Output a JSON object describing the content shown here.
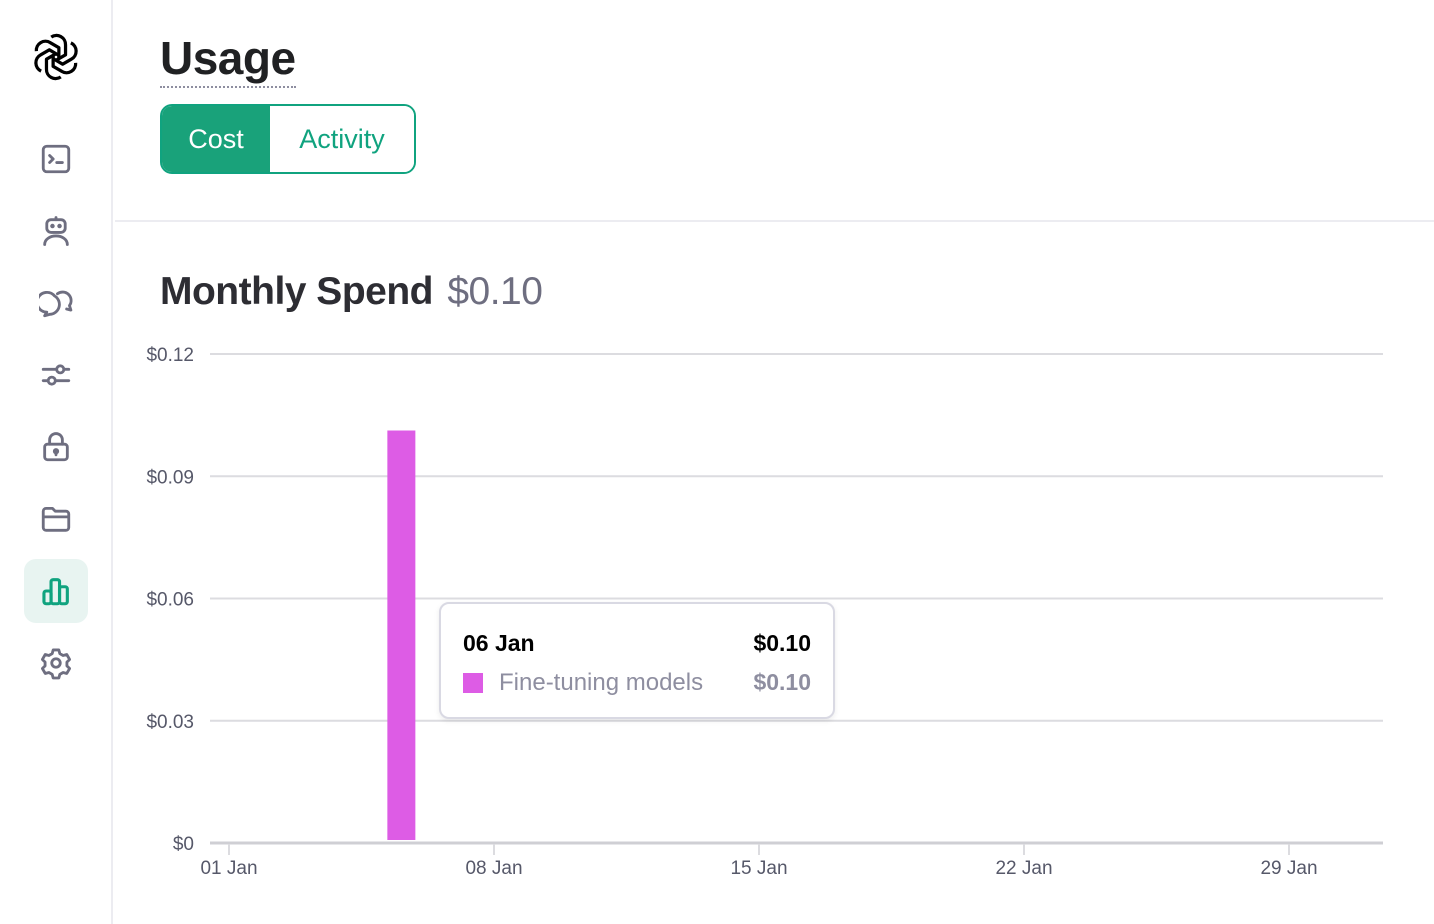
{
  "sidebar": {
    "logo": "openai-logo",
    "items": [
      {
        "name": "playground",
        "icon": "terminal-icon",
        "active": false
      },
      {
        "name": "assistants",
        "icon": "robot-icon",
        "active": false
      },
      {
        "name": "threads",
        "icon": "chat-bubbles-icon",
        "active": false
      },
      {
        "name": "fine-tuning",
        "icon": "sliders-icon",
        "active": false
      },
      {
        "name": "api-keys",
        "icon": "lock-icon",
        "active": false
      },
      {
        "name": "files",
        "icon": "folder-icon",
        "active": false
      },
      {
        "name": "usage",
        "icon": "bar-chart-icon",
        "active": true
      },
      {
        "name": "settings",
        "icon": "gear-icon",
        "active": false
      }
    ],
    "active_color": "#10a37f"
  },
  "header": {
    "title": "Usage",
    "tabs": [
      {
        "label": "Cost",
        "active": true
      },
      {
        "label": "Activity",
        "active": false
      }
    ]
  },
  "section": {
    "title": "Monthly Spend",
    "amount": "$0.10"
  },
  "tooltip": {
    "date": "06 Jan",
    "total": "$0.10",
    "rows": [
      {
        "label": "Fine-tuning models",
        "value": "$0.10",
        "color": "#dd5ce5"
      }
    ]
  },
  "chart_data": {
    "type": "bar",
    "title": "Monthly Spend",
    "xlabel": "",
    "ylabel": "",
    "x_days": [
      1,
      2,
      3,
      4,
      5,
      6,
      7,
      8,
      9,
      10,
      11,
      12,
      13,
      14,
      15,
      16,
      17,
      18,
      19,
      20,
      21,
      22,
      23,
      24,
      25,
      26,
      27,
      28,
      29,
      30,
      31
    ],
    "series": [
      {
        "name": "Fine-tuning models",
        "color": "#dd5ce5",
        "values": [
          0,
          0,
          0,
          0,
          0,
          0.1,
          0,
          0,
          0,
          0,
          0,
          0,
          0,
          0,
          0,
          0,
          0,
          0,
          0,
          0,
          0,
          0,
          0,
          0,
          0,
          0,
          0,
          0,
          0,
          0,
          0
        ]
      }
    ],
    "xticks": [
      {
        "day": 1,
        "label": "01 Jan"
      },
      {
        "day": 8,
        "label": "08 Jan"
      },
      {
        "day": 15,
        "label": "15 Jan"
      },
      {
        "day": 22,
        "label": "22 Jan"
      },
      {
        "day": 29,
        "label": "29 Jan"
      }
    ],
    "yticks": [
      {
        "value": 0,
        "label": "$0"
      },
      {
        "value": 0.03,
        "label": "$0.03"
      },
      {
        "value": 0.06,
        "label": "$0.06"
      },
      {
        "value": 0.09,
        "label": "$0.09"
      },
      {
        "value": 0.12,
        "label": "$0.12"
      }
    ],
    "ylim": [
      0,
      0.12
    ],
    "xlim_days": [
      0.5,
      31.5
    ],
    "grid": true,
    "legend": "none"
  }
}
